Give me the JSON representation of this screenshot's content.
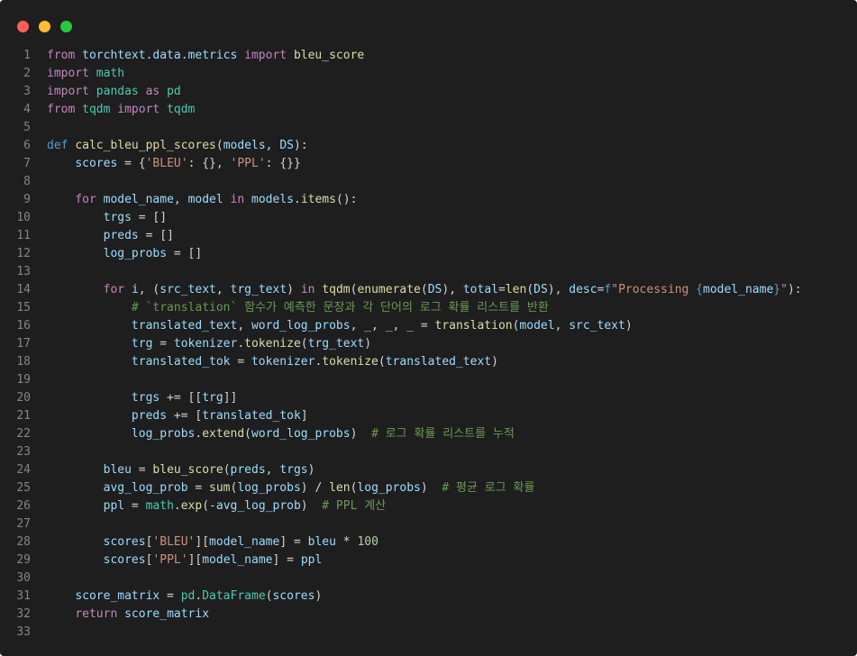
{
  "window": {
    "buttons": {
      "close": "close",
      "minimize": "minimize",
      "maximize": "maximize"
    }
  },
  "code": {
    "lines": [
      {
        "n": "1",
        "tokens": [
          [
            "kw",
            "from"
          ],
          [
            "op",
            " "
          ],
          [
            "var",
            "torchtext.data.metrics"
          ],
          [
            "op",
            " "
          ],
          [
            "kw",
            "import"
          ],
          [
            "op",
            " "
          ],
          [
            "fn",
            "bleu_score"
          ]
        ]
      },
      {
        "n": "2",
        "tokens": [
          [
            "kw",
            "import"
          ],
          [
            "op",
            " "
          ],
          [
            "cls",
            "math"
          ]
        ]
      },
      {
        "n": "3",
        "tokens": [
          [
            "kw",
            "import"
          ],
          [
            "op",
            " "
          ],
          [
            "cls",
            "pandas"
          ],
          [
            "op",
            " "
          ],
          [
            "kw",
            "as"
          ],
          [
            "op",
            " "
          ],
          [
            "cls",
            "pd"
          ]
        ]
      },
      {
        "n": "4",
        "tokens": [
          [
            "kw",
            "from"
          ],
          [
            "op",
            " "
          ],
          [
            "cls",
            "tqdm"
          ],
          [
            "op",
            " "
          ],
          [
            "kw",
            "import"
          ],
          [
            "op",
            " "
          ],
          [
            "cls",
            "tqdm"
          ]
        ]
      },
      {
        "n": "5",
        "tokens": []
      },
      {
        "n": "6",
        "tokens": [
          [
            "def",
            "def"
          ],
          [
            "op",
            " "
          ],
          [
            "fn",
            "calc_bleu_ppl_scores"
          ],
          [
            "op",
            "("
          ],
          [
            "var",
            "models"
          ],
          [
            "op",
            ", "
          ],
          [
            "var",
            "DS"
          ],
          [
            "op",
            "):"
          ]
        ]
      },
      {
        "n": "7",
        "tokens": [
          [
            "op",
            "    "
          ],
          [
            "var",
            "scores"
          ],
          [
            "op",
            " = {"
          ],
          [
            "str",
            "'BLEU'"
          ],
          [
            "op",
            ": {}, "
          ],
          [
            "str",
            "'PPL'"
          ],
          [
            "op",
            ": {}}"
          ]
        ]
      },
      {
        "n": "8",
        "tokens": []
      },
      {
        "n": "9",
        "tokens": [
          [
            "op",
            "    "
          ],
          [
            "kw",
            "for"
          ],
          [
            "op",
            " "
          ],
          [
            "var",
            "model_name"
          ],
          [
            "op",
            ", "
          ],
          [
            "var",
            "model"
          ],
          [
            "op",
            " "
          ],
          [
            "kw",
            "in"
          ],
          [
            "op",
            " "
          ],
          [
            "var",
            "models"
          ],
          [
            "op",
            "."
          ],
          [
            "fn",
            "items"
          ],
          [
            "op",
            "():"
          ]
        ]
      },
      {
        "n": "10",
        "tokens": [
          [
            "op",
            "        "
          ],
          [
            "var",
            "trgs"
          ],
          [
            "op",
            " = []"
          ]
        ]
      },
      {
        "n": "11",
        "tokens": [
          [
            "op",
            "        "
          ],
          [
            "var",
            "preds"
          ],
          [
            "op",
            " = []"
          ]
        ]
      },
      {
        "n": "12",
        "tokens": [
          [
            "op",
            "        "
          ],
          [
            "var",
            "log_probs"
          ],
          [
            "op",
            " = []"
          ]
        ]
      },
      {
        "n": "13",
        "tokens": []
      },
      {
        "n": "14",
        "tokens": [
          [
            "op",
            "        "
          ],
          [
            "kw",
            "for"
          ],
          [
            "op",
            " "
          ],
          [
            "var",
            "i"
          ],
          [
            "op",
            ", ("
          ],
          [
            "var",
            "src_text"
          ],
          [
            "op",
            ", "
          ],
          [
            "var",
            "trg_text"
          ],
          [
            "op",
            ") "
          ],
          [
            "kw",
            "in"
          ],
          [
            "op",
            " "
          ],
          [
            "fn",
            "tqdm"
          ],
          [
            "op",
            "("
          ],
          [
            "fn",
            "enumerate"
          ],
          [
            "op",
            "("
          ],
          [
            "var",
            "DS"
          ],
          [
            "op",
            "), "
          ],
          [
            "var",
            "total"
          ],
          [
            "op",
            "="
          ],
          [
            "fn",
            "len"
          ],
          [
            "op",
            "("
          ],
          [
            "var",
            "DS"
          ],
          [
            "op",
            "), "
          ],
          [
            "var",
            "desc"
          ],
          [
            "op",
            "="
          ],
          [
            "def",
            "f"
          ],
          [
            "str",
            "\"Processing "
          ],
          [
            "def",
            "{"
          ],
          [
            "var",
            "model_name"
          ],
          [
            "def",
            "}"
          ],
          [
            "str",
            "\""
          ],
          [
            "op",
            "):"
          ]
        ]
      },
      {
        "n": "15",
        "tokens": [
          [
            "op",
            "            "
          ],
          [
            "cm",
            "# `translation` 함수가 예측한 문장과 각 단어의 로그 확률 리스트를 반환"
          ]
        ]
      },
      {
        "n": "16",
        "tokens": [
          [
            "op",
            "            "
          ],
          [
            "var",
            "translated_text"
          ],
          [
            "op",
            ", "
          ],
          [
            "var",
            "word_log_probs"
          ],
          [
            "op",
            ", "
          ],
          [
            "var",
            "_"
          ],
          [
            "op",
            ", "
          ],
          [
            "var",
            "_"
          ],
          [
            "op",
            ", "
          ],
          [
            "var",
            "_"
          ],
          [
            "op",
            " = "
          ],
          [
            "fn",
            "translation"
          ],
          [
            "op",
            "("
          ],
          [
            "var",
            "model"
          ],
          [
            "op",
            ", "
          ],
          [
            "var",
            "src_text"
          ],
          [
            "op",
            ")"
          ]
        ]
      },
      {
        "n": "17",
        "tokens": [
          [
            "op",
            "            "
          ],
          [
            "var",
            "trg"
          ],
          [
            "op",
            " = "
          ],
          [
            "var",
            "tokenizer"
          ],
          [
            "op",
            "."
          ],
          [
            "fn",
            "tokenize"
          ],
          [
            "op",
            "("
          ],
          [
            "var",
            "trg_text"
          ],
          [
            "op",
            ")"
          ]
        ]
      },
      {
        "n": "18",
        "tokens": [
          [
            "op",
            "            "
          ],
          [
            "var",
            "translated_tok"
          ],
          [
            "op",
            " = "
          ],
          [
            "var",
            "tokenizer"
          ],
          [
            "op",
            "."
          ],
          [
            "fn",
            "tokenize"
          ],
          [
            "op",
            "("
          ],
          [
            "var",
            "translated_text"
          ],
          [
            "op",
            ")"
          ]
        ]
      },
      {
        "n": "19",
        "tokens": []
      },
      {
        "n": "20",
        "tokens": [
          [
            "op",
            "            "
          ],
          [
            "var",
            "trgs"
          ],
          [
            "op",
            " += [["
          ],
          [
            "var",
            "trg"
          ],
          [
            "op",
            "]]"
          ]
        ]
      },
      {
        "n": "21",
        "tokens": [
          [
            "op",
            "            "
          ],
          [
            "var",
            "preds"
          ],
          [
            "op",
            " += ["
          ],
          [
            "var",
            "translated_tok"
          ],
          [
            "op",
            "]"
          ]
        ]
      },
      {
        "n": "22",
        "tokens": [
          [
            "op",
            "            "
          ],
          [
            "var",
            "log_probs"
          ],
          [
            "op",
            "."
          ],
          [
            "fn",
            "extend"
          ],
          [
            "op",
            "("
          ],
          [
            "var",
            "word_log_probs"
          ],
          [
            "op",
            ")  "
          ],
          [
            "cm",
            "# 로그 확률 리스트를 누적"
          ]
        ]
      },
      {
        "n": "23",
        "tokens": []
      },
      {
        "n": "24",
        "tokens": [
          [
            "op",
            "        "
          ],
          [
            "var",
            "bleu"
          ],
          [
            "op",
            " = "
          ],
          [
            "fn",
            "bleu_score"
          ],
          [
            "op",
            "("
          ],
          [
            "var",
            "preds"
          ],
          [
            "op",
            ", "
          ],
          [
            "var",
            "trgs"
          ],
          [
            "op",
            ")"
          ]
        ]
      },
      {
        "n": "25",
        "tokens": [
          [
            "op",
            "        "
          ],
          [
            "var",
            "avg_log_prob"
          ],
          [
            "op",
            " = "
          ],
          [
            "fn",
            "sum"
          ],
          [
            "op",
            "("
          ],
          [
            "var",
            "log_probs"
          ],
          [
            "op",
            ") / "
          ],
          [
            "fn",
            "len"
          ],
          [
            "op",
            "("
          ],
          [
            "var",
            "log_probs"
          ],
          [
            "op",
            ")  "
          ],
          [
            "cm",
            "# 평균 로그 확률"
          ]
        ]
      },
      {
        "n": "26",
        "tokens": [
          [
            "op",
            "        "
          ],
          [
            "var",
            "ppl"
          ],
          [
            "op",
            " = "
          ],
          [
            "cls",
            "math"
          ],
          [
            "op",
            "."
          ],
          [
            "fn",
            "exp"
          ],
          [
            "op",
            "(-"
          ],
          [
            "var",
            "avg_log_prob"
          ],
          [
            "op",
            ")  "
          ],
          [
            "cm",
            "# PPL 계산"
          ]
        ]
      },
      {
        "n": "27",
        "tokens": []
      },
      {
        "n": "28",
        "tokens": [
          [
            "op",
            "        "
          ],
          [
            "var",
            "scores"
          ],
          [
            "op",
            "["
          ],
          [
            "str",
            "'BLEU'"
          ],
          [
            "op",
            "]["
          ],
          [
            "var",
            "model_name"
          ],
          [
            "op",
            "] = "
          ],
          [
            "var",
            "bleu"
          ],
          [
            "op",
            " * "
          ],
          [
            "num",
            "100"
          ]
        ]
      },
      {
        "n": "29",
        "tokens": [
          [
            "op",
            "        "
          ],
          [
            "var",
            "scores"
          ],
          [
            "op",
            "["
          ],
          [
            "str",
            "'PPL'"
          ],
          [
            "op",
            "]["
          ],
          [
            "var",
            "model_name"
          ],
          [
            "op",
            "] = "
          ],
          [
            "var",
            "ppl"
          ]
        ]
      },
      {
        "n": "30",
        "tokens": []
      },
      {
        "n": "31",
        "tokens": [
          [
            "op",
            "    "
          ],
          [
            "var",
            "score_matrix"
          ],
          [
            "op",
            " = "
          ],
          [
            "cls",
            "pd"
          ],
          [
            "op",
            "."
          ],
          [
            "cls",
            "DataFrame"
          ],
          [
            "op",
            "("
          ],
          [
            "var",
            "scores"
          ],
          [
            "op",
            ")"
          ]
        ]
      },
      {
        "n": "32",
        "tokens": [
          [
            "op",
            "    "
          ],
          [
            "kw",
            "return"
          ],
          [
            "op",
            " "
          ],
          [
            "var",
            "score_matrix"
          ]
        ]
      },
      {
        "n": "33",
        "tokens": []
      }
    ]
  }
}
